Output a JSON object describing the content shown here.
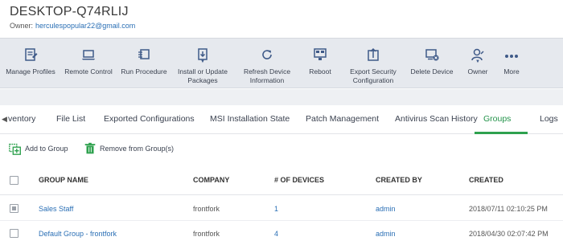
{
  "device": {
    "title": "DESKTOP-Q74RLIJ",
    "owner_label": "Owner:",
    "owner_email": "herculespopular22@gmail.com"
  },
  "toolbar": {
    "items": [
      {
        "label": "Manage Profiles",
        "icon": "manage-profiles-icon"
      },
      {
        "label": "Remote Control",
        "icon": "laptop-icon"
      },
      {
        "label": "Run Procedure",
        "icon": "run-procedure-icon"
      },
      {
        "label": "Install or Update\nPackages",
        "icon": "install-package-icon",
        "has_dropdown": true
      },
      {
        "label": "Refresh Device\nInformation",
        "icon": "refresh-icon"
      },
      {
        "label": "Reboot",
        "icon": "reboot-icon"
      },
      {
        "label": "Export Security\nConfiguration",
        "icon": "export-config-icon"
      },
      {
        "label": "Delete Device",
        "icon": "delete-device-icon"
      },
      {
        "label": "Owner",
        "icon": "owner-icon",
        "has_dropdown": true
      },
      {
        "label": "More",
        "icon": "more-icon"
      }
    ]
  },
  "tabs": {
    "items": [
      "ventory",
      "File List",
      "Exported Configurations",
      "MSI Installation State",
      "Patch Management",
      "Antivirus Scan History",
      "Groups",
      "Logs"
    ],
    "active": "Groups"
  },
  "actions": {
    "add_label": "Add to Group",
    "remove_label": "Remove from Group(s)"
  },
  "table": {
    "columns": [
      "GROUP NAME",
      "COMPANY",
      "# OF DEVICES",
      "CREATED BY",
      "CREATED"
    ],
    "rows": [
      {
        "group_name": "Sales Staff",
        "company": "frontfork",
        "devices": "1",
        "created_by": "admin",
        "created": "2018/07/11 02:10:25 PM"
      },
      {
        "group_name": "Default Group - frontfork",
        "company": "frontfork",
        "devices": "4",
        "created_by": "admin",
        "created": "2018/04/30 02:07:42 PM"
      }
    ]
  },
  "colors": {
    "accent_green": "#2ea14e",
    "link_blue": "#2a6fb5",
    "toolbar_bg": "#e6e9ee",
    "icon_navy": "#3f5a88"
  }
}
